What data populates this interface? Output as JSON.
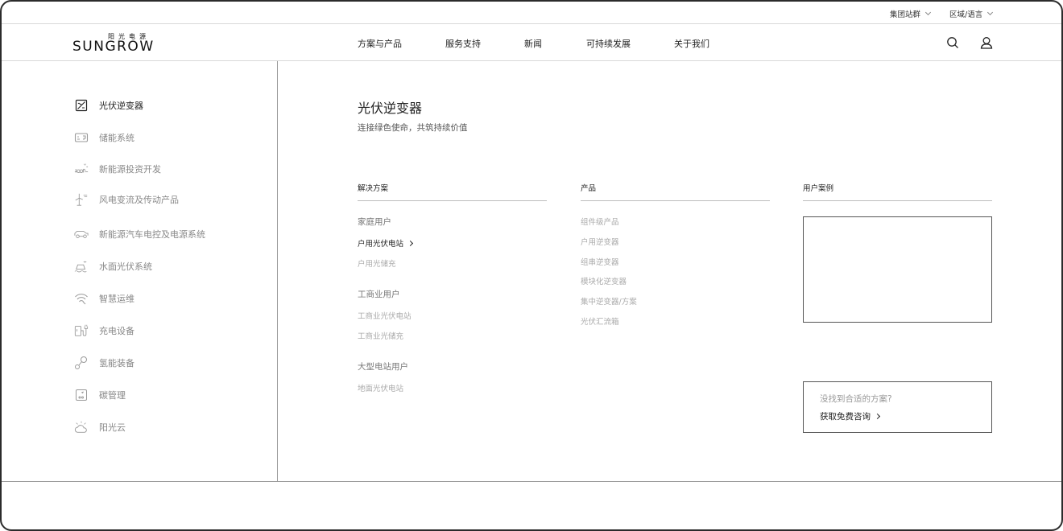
{
  "utility": {
    "group_sites": "集团站群",
    "region_lang": "区域/语言"
  },
  "logo": {
    "cn": "阳光电源",
    "en": "SUNGROW"
  },
  "nav": [
    {
      "label": "方案与产品"
    },
    {
      "label": "服务支持"
    },
    {
      "label": "新闻"
    },
    {
      "label": "可持续发展"
    },
    {
      "label": "关于我们"
    }
  ],
  "header_icons": {
    "search": "search-icon",
    "account": "user-icon"
  },
  "sidebar": {
    "items": [
      {
        "label": "光伏逆变器",
        "icon": "pv-inverter-icon",
        "active": true
      },
      {
        "label": "储能系统",
        "icon": "energy-storage-icon"
      },
      {
        "label": "新能源投资开发",
        "icon": "investment-icon"
      },
      {
        "label": "风电变流及传动产品",
        "icon": "wind-turbine-icon"
      },
      {
        "label": "新能源汽车电控及电源系统",
        "icon": "ev-icon"
      },
      {
        "label": "水面光伏系统",
        "icon": "floating-pv-icon"
      },
      {
        "label": "智慧运维",
        "icon": "smart-om-icon"
      },
      {
        "label": "充电设备",
        "icon": "charger-icon"
      },
      {
        "label": "氢能装备",
        "icon": "hydrogen-icon"
      },
      {
        "label": "碳管理",
        "icon": "carbon-icon"
      },
      {
        "label": "阳光云",
        "icon": "cloud-icon"
      }
    ]
  },
  "main": {
    "title": "光伏逆变器",
    "subtitle": "连接绿色使命，共筑持续价值",
    "columns": {
      "solutions": {
        "header": "解决方案",
        "groups": [
          {
            "title": "家庭用户",
            "links": [
              "户用光伏电站",
              "户用光储充"
            ]
          },
          {
            "title": "工商业用户",
            "links": [
              "工商业光伏电站",
              "工商业光储充"
            ]
          },
          {
            "title": "大型电站用户",
            "links": [
              "地面光伏电站"
            ]
          }
        ]
      },
      "products": {
        "header": "产品",
        "links": [
          "组件级产品",
          "户用逆变器",
          "组串逆变器",
          "模块化逆变器",
          "集中逆变器/方案",
          "光伏汇流箱"
        ]
      },
      "cases": {
        "header": "用户案例"
      }
    },
    "cta": {
      "question": "没找到合适的方案?",
      "link": "获取免费咨询"
    }
  }
}
